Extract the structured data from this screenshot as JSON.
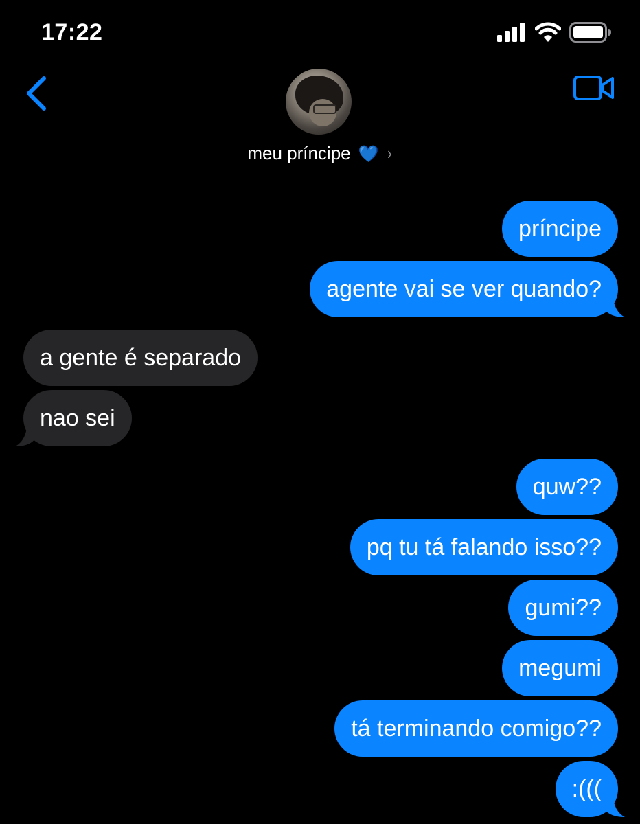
{
  "status_bar": {
    "time": "17:22"
  },
  "header": {
    "contact_name": "meu príncipe",
    "name_emoji": "💙",
    "chevron": "›"
  },
  "icons": {
    "back": "chevron-left-icon",
    "video": "video-camera-icon",
    "signal": "cellular-signal-icon",
    "wifi": "wifi-icon",
    "battery": "battery-icon"
  },
  "colors": {
    "background": "#000000",
    "sent_bubble": "#0a84ff",
    "received_bubble": "#262628",
    "accent": "#0a84ff"
  },
  "messages": [
    {
      "direction": "sent",
      "text": "príncipe"
    },
    {
      "direction": "sent",
      "text": "agente vai se ver quando?"
    },
    {
      "direction": "received",
      "text": "a gente é separado"
    },
    {
      "direction": "received",
      "text": "nao sei"
    },
    {
      "direction": "sent",
      "text": "quw??"
    },
    {
      "direction": "sent",
      "text": "pq tu tá falando isso??"
    },
    {
      "direction": "sent",
      "text": "gumi??"
    },
    {
      "direction": "sent",
      "text": "megumi"
    },
    {
      "direction": "sent",
      "text": "tá terminando comigo??"
    },
    {
      "direction": "sent",
      "text": ":((("
    }
  ]
}
